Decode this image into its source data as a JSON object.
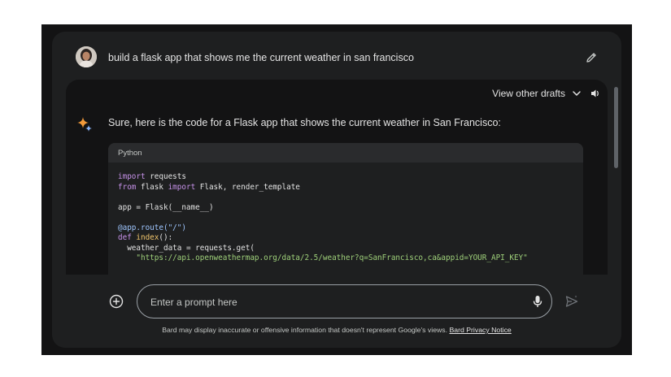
{
  "query": {
    "text": "build a flask app that shows me the current weather in san francisco"
  },
  "response": {
    "drafts_label": "View other drafts",
    "intro": "Sure, here is the code for a Flask app that shows the current weather in San Francisco:",
    "code": {
      "language": "Python",
      "lines": [
        {
          "k1": "import",
          "t1": " requests"
        },
        {
          "k1": "from",
          "t1": " flask ",
          "k2": "import",
          "t2": " Flask, render_template"
        },
        {
          "t1": ""
        },
        {
          "t1": "app = Flask(__name__)"
        },
        {
          "t1": ""
        },
        {
          "dec": "@app.route(\"/\")"
        },
        {
          "k1": "def",
          "fn": " index",
          "t1": "():"
        },
        {
          "t1": "  weather_data = requests.get("
        },
        {
          "str": "    \"https://api.openweathermap.org/data/2.5/weather?q=SanFrancisco,ca&appid=YOUR_API_KEY\""
        }
      ]
    }
  },
  "input": {
    "placeholder": "Enter a prompt here"
  },
  "footer": {
    "disclaimer": "Bard may display inaccurate or offensive information that doesn't represent Google's views.",
    "privacy_link": "Bard Privacy Notice"
  },
  "icons": {
    "edit": "pencil-icon",
    "chevron": "chevron-down-icon",
    "speaker": "speaker-icon",
    "spark": "bard-sparkle-icon",
    "add": "add-circle-icon",
    "mic": "microphone-icon",
    "send": "send-icon"
  },
  "colors": {
    "background": "#131314",
    "panel": "#1e1f20",
    "text": "#e3e3e3",
    "spark_orange": "#f29a3a",
    "spark_blue": "#8ab4f8"
  }
}
